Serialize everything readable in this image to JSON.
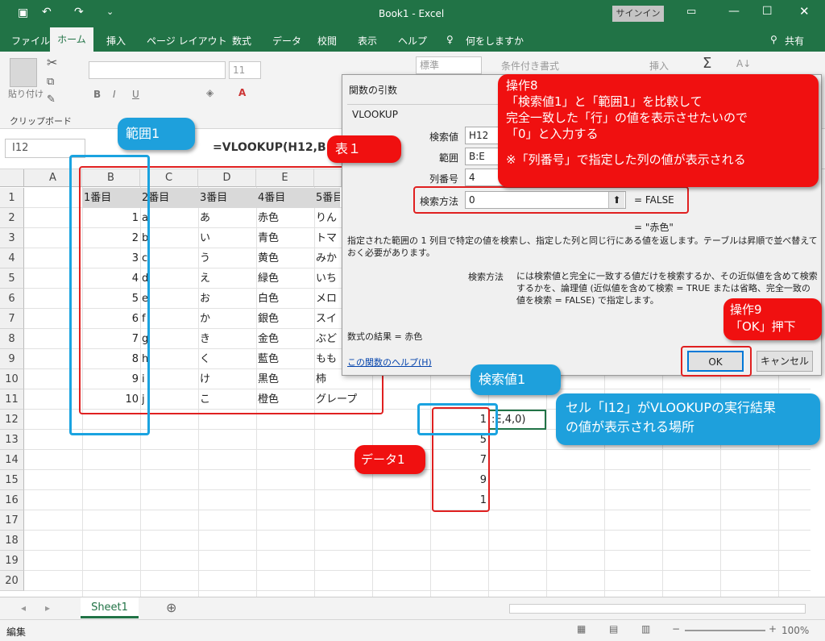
{
  "titlebar": {
    "title": "Book1  -  Excel",
    "signin": "サインイン"
  },
  "tabs": [
    "ファイル",
    "ホーム",
    "挿入",
    "ページ レイアウト",
    "数式",
    "データ",
    "校閲",
    "表示",
    "ヘルプ",
    "何をしますか"
  ],
  "share": "共有",
  "ribbon": {
    "paste": "貼り付け",
    "clipboard": "クリップボード",
    "font_size": "11",
    "number_format": "標準",
    "conditional": "条件付き書式",
    "insert": "挿入"
  },
  "namebox": "I12",
  "formula": "=VLOOKUP(H12,B:",
  "columns": [
    "A",
    "B",
    "C",
    "D",
    "E"
  ],
  "rows": [
    "1",
    "2",
    "3",
    "4",
    "5",
    "6",
    "7",
    "8",
    "9",
    "10",
    "11",
    "12",
    "13",
    "14",
    "15",
    "16",
    "17",
    "18",
    "19",
    "20"
  ],
  "table": {
    "header": [
      "1番目",
      "2番目",
      "3番目",
      "4番目",
      "5番目"
    ],
    "b": [
      "1",
      "2",
      "3",
      "4",
      "5",
      "6",
      "7",
      "8",
      "9",
      "10"
    ],
    "c": [
      "a",
      "b",
      "c",
      "d",
      "e",
      "f",
      "g",
      "h",
      "i",
      "j"
    ],
    "d": [
      "あ",
      "い",
      "う",
      "え",
      "お",
      "か",
      "き",
      "く",
      "け",
      "こ"
    ],
    "e": [
      "赤色",
      "青色",
      "黄色",
      "緑色",
      "白色",
      "銀色",
      "金色",
      "藍色",
      "黒色",
      "橙色"
    ],
    "f": [
      "りん",
      "トマ",
      "みか",
      "いち",
      "メロ",
      "スイ",
      "ぶど",
      "もも",
      "柿",
      "グレープ"
    ]
  },
  "h_values": [
    "1",
    "5",
    "7",
    "9",
    "1"
  ],
  "i12_text": ":E,4,0)",
  "dialog": {
    "title": "関数の引数",
    "func": "VLOOKUP",
    "labels": [
      "検索値",
      "範囲",
      "列番号",
      "検索方法"
    ],
    "values": [
      "H12",
      "B:E",
      "4",
      "0"
    ],
    "result_false": "=  FALSE",
    "result_akairo": "=  \"赤色\"",
    "desc": "指定された範囲の 1 列目で特定の値を検索し、指定した列と同じ行にある値を返します。テーブルは昇順で並べ替えておく必要があります。",
    "param_name": "検索方法",
    "param_desc": "には検索値と完全に一致する値だけを検索するか、その近似値を含めて検索するかを、論理値 (近似値を含めて検索 = TRUE または省略、完全一致の値を検索 = FALSE) で指定します。",
    "formula_result": "数式の結果 =   赤色",
    "help_link": "この関数のヘルプ(H)",
    "ok": "OK",
    "cancel": "キャンセル"
  },
  "callouts": {
    "hanni1": "範囲1",
    "hyo1": "表１",
    "op8": [
      "操作8",
      "「検索値1」と「範囲1」を比較して",
      "完全一致した「行」の値を表示させたいので",
      "「0」と入力する",
      "",
      "※「列番号」で指定した列の値が表示される"
    ],
    "op9": [
      "操作9",
      "「OK」押下"
    ],
    "kensakuchi1": "検索値1",
    "data1": "データ1",
    "i12_note": [
      "セル「I12」がVLOOKUPの実行結果",
      "の値が表示される場所"
    ]
  },
  "sheet_tab": "Sheet1",
  "status": {
    "mode": "編集",
    "zoom": "100%"
  }
}
